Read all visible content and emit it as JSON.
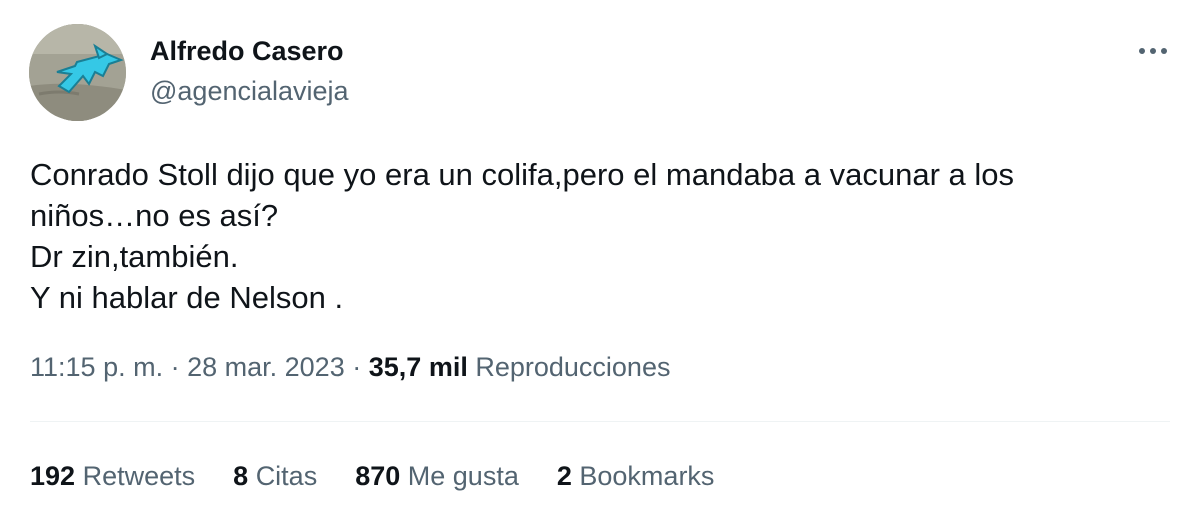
{
  "author": {
    "display_name": "Alfredo Casero",
    "handle": "@agencialavieja",
    "avatar_icon": "hammerhead-shark-avatar"
  },
  "more_icon": "more-horizontal-icon",
  "tweet": {
    "lines": [
      "Conrado Stoll dijo que yo era un colifa,pero el mandaba a vacunar a los",
      "niños…no es así?",
      "Dr zin,también.",
      "Y ni hablar de Nelson ."
    ]
  },
  "meta": {
    "time": "11:15 p. m.",
    "separator": "·",
    "date": "28 mar. 2023",
    "views_count": "35,7 mil",
    "views_label": "Reproducciones"
  },
  "stats": [
    {
      "count": "192",
      "label": "Retweets"
    },
    {
      "count": "8",
      "label": "Citas"
    },
    {
      "count": "870",
      "label": "Me gusta"
    },
    {
      "count": "2",
      "label": "Bookmarks"
    }
  ],
  "colors": {
    "primary_text": "#0f1419",
    "secondary_text": "#536471",
    "divider": "#eff3f4",
    "avatar_shark": "#35c8e6"
  }
}
